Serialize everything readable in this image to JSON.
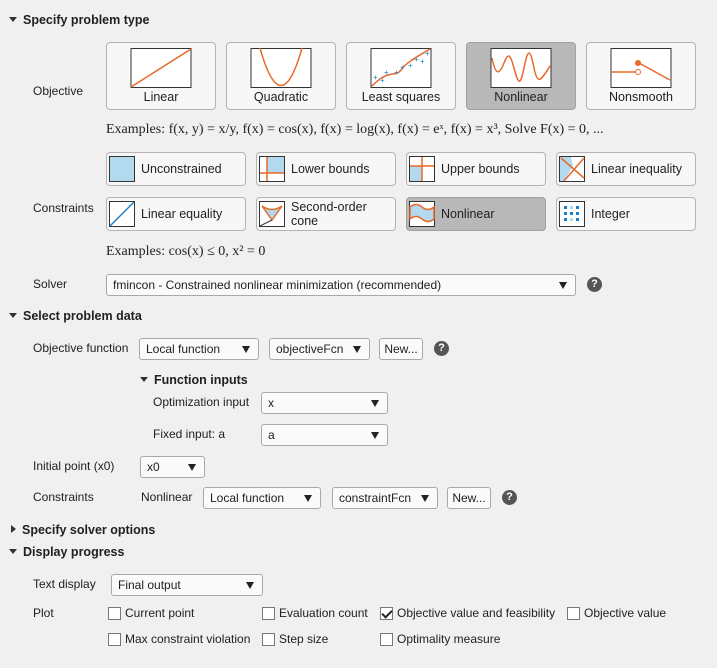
{
  "sections": {
    "problem_type": "Specify problem type",
    "problem_data": "Select problem data",
    "solver_options": "Specify solver options",
    "display_progress": "Display progress"
  },
  "objective": {
    "label": "Objective",
    "options": [
      "Linear",
      "Quadratic",
      "Least squares",
      "Nonlinear",
      "Nonsmooth"
    ],
    "selected": "Nonlinear",
    "examples": "Examples: f(x, y) = x/y, f(x) = cos(x), f(x) = log(x), f(x) = eˣ, f(x) = x³,  Solve F(x) = 0, ..."
  },
  "constraints": {
    "label": "Constraints",
    "options": [
      "Unconstrained",
      "Lower bounds",
      "Upper bounds",
      "Linear inequality",
      "Linear equality",
      "Second-order cone",
      "Nonlinear",
      "Integer"
    ],
    "selected": "Nonlinear",
    "examples": "Examples:  cos(x) ≤ 0, x² = 0"
  },
  "solver": {
    "label": "Solver",
    "value": "fmincon - Constrained nonlinear minimization (recommended)"
  },
  "data": {
    "objective_function_label": "Objective function",
    "objective_source": "Local function",
    "objective_fcn": "objectiveFcn",
    "new_label": "New...",
    "function_inputs": "Function inputs",
    "optimization_input_label": "Optimization input",
    "optimization_input": "x",
    "fixed_input_label": "Fixed input: a",
    "fixed_input": "a",
    "initial_point_label": "Initial point (x0)",
    "initial_point": "x0",
    "constraints_label": "Constraints",
    "nonlinear_label": "Nonlinear",
    "constraint_source": "Local function",
    "constraint_fcn": "constraintFcn"
  },
  "display": {
    "text_display_label": "Text display",
    "text_display": "Final output",
    "plot_label": "Plot",
    "plots": [
      {
        "label": "Current point",
        "checked": false
      },
      {
        "label": "Evaluation count",
        "checked": false
      },
      {
        "label": "Objective value and feasibility",
        "checked": true
      },
      {
        "label": "Objective value",
        "checked": false
      },
      {
        "label": "Max constraint violation",
        "checked": false
      },
      {
        "label": "Step size",
        "checked": false
      },
      {
        "label": "Optimality measure",
        "checked": false
      }
    ]
  },
  "colors": {
    "accent": "#e8692a",
    "fill": "#b3d9ee",
    "selected": "#b8b8b8"
  }
}
